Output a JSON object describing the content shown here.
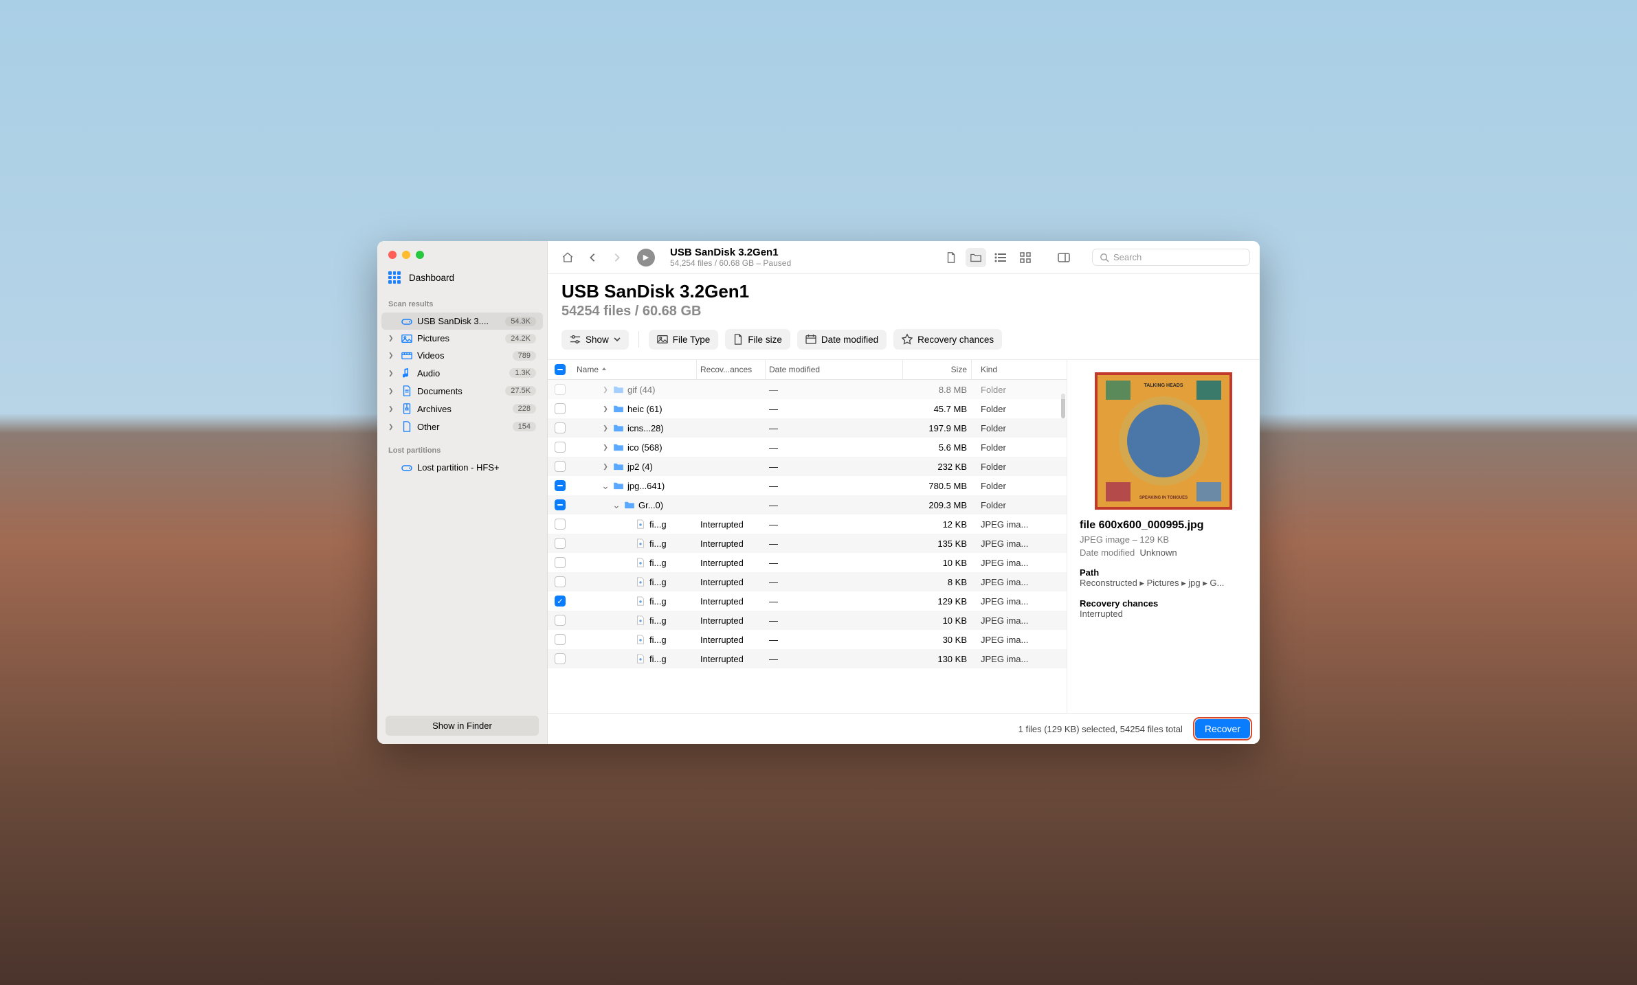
{
  "sidebar": {
    "dashboard_label": "Dashboard",
    "section_scan_results": "Scan results",
    "section_lost_partitions": "Lost partitions",
    "items": [
      {
        "label": "USB  SanDisk 3....",
        "badge": "54.3K",
        "icon": "disk",
        "chev": false,
        "active": true
      },
      {
        "label": "Pictures",
        "badge": "24.2K",
        "icon": "image",
        "chev": true
      },
      {
        "label": "Videos",
        "badge": "789",
        "icon": "video",
        "chev": true
      },
      {
        "label": "Audio",
        "badge": "1.3K",
        "icon": "audio",
        "chev": true
      },
      {
        "label": "Documents",
        "badge": "27.5K",
        "icon": "doc",
        "chev": true
      },
      {
        "label": "Archives",
        "badge": "228",
        "icon": "archive",
        "chev": true
      },
      {
        "label": "Other",
        "badge": "154",
        "icon": "other",
        "chev": true
      }
    ],
    "lost_item": "Lost partition - HFS+",
    "show_finder": "Show in Finder"
  },
  "toolbar": {
    "title": "USB  SanDisk 3.2Gen1",
    "subtitle": "54,254 files / 60.68 GB – Paused",
    "search_placeholder": "Search"
  },
  "heading": {
    "title": "USB  SanDisk 3.2Gen1",
    "subtitle": "54254 files / 60.68 GB"
  },
  "filters": {
    "show": "Show",
    "file_type": "File Type",
    "file_size": "File size",
    "date_modified": "Date modified",
    "recovery_chances": "Recovery chances"
  },
  "columns": {
    "name": "Name",
    "recovery": "Recov...ances",
    "date": "Date modified",
    "size": "Size",
    "kind": "Kind"
  },
  "rows": [
    {
      "cb": "none",
      "indent": 2,
      "caret": "right",
      "icon": "folder",
      "name": "gif (44)",
      "rec": "",
      "date": "—",
      "size": "8.8 MB",
      "kind": "Folder",
      "alt": true,
      "faded": true
    },
    {
      "cb": "none",
      "indent": 2,
      "caret": "right",
      "icon": "folder",
      "name": "heic (61)",
      "rec": "",
      "date": "—",
      "size": "45.7 MB",
      "kind": "Folder"
    },
    {
      "cb": "none",
      "indent": 2,
      "caret": "right",
      "icon": "folder",
      "name": "icns...28)",
      "rec": "",
      "date": "—",
      "size": "197.9 MB",
      "kind": "Folder",
      "alt": true
    },
    {
      "cb": "none",
      "indent": 2,
      "caret": "right",
      "icon": "folder",
      "name": "ico (568)",
      "rec": "",
      "date": "—",
      "size": "5.6 MB",
      "kind": "Folder"
    },
    {
      "cb": "none",
      "indent": 2,
      "caret": "right",
      "icon": "folder",
      "name": "jp2 (4)",
      "rec": "",
      "date": "—",
      "size": "232 KB",
      "kind": "Folder",
      "alt": true
    },
    {
      "cb": "ind",
      "indent": 2,
      "caret": "down",
      "icon": "folder",
      "name": "jpg...641)",
      "rec": "",
      "date": "—",
      "size": "780.5 MB",
      "kind": "Folder"
    },
    {
      "cb": "ind",
      "indent": 3,
      "caret": "down",
      "icon": "folder",
      "name": "Gr...0)",
      "rec": "",
      "date": "—",
      "size": "209.3 MB",
      "kind": "Folder",
      "alt": true
    },
    {
      "cb": "none",
      "indent": 4,
      "caret": "",
      "icon": "file",
      "name": "fi...g",
      "rec": "Interrupted",
      "date": "—",
      "size": "12 KB",
      "kind": "JPEG ima..."
    },
    {
      "cb": "none",
      "indent": 4,
      "caret": "",
      "icon": "file",
      "name": "fi...g",
      "rec": "Interrupted",
      "date": "—",
      "size": "135 KB",
      "kind": "JPEG ima...",
      "alt": true
    },
    {
      "cb": "none",
      "indent": 4,
      "caret": "",
      "icon": "file",
      "name": "fi...g",
      "rec": "Interrupted",
      "date": "—",
      "size": "10 KB",
      "kind": "JPEG ima..."
    },
    {
      "cb": "none",
      "indent": 4,
      "caret": "",
      "icon": "file",
      "name": "fi...g",
      "rec": "Interrupted",
      "date": "—",
      "size": "8 KB",
      "kind": "JPEG ima...",
      "alt": true
    },
    {
      "cb": "chk",
      "indent": 4,
      "caret": "",
      "icon": "file",
      "name": "fi...g",
      "rec": "Interrupted",
      "date": "—",
      "size": "129 KB",
      "kind": "JPEG ima..."
    },
    {
      "cb": "none",
      "indent": 4,
      "caret": "",
      "icon": "file",
      "name": "fi...g",
      "rec": "Interrupted",
      "date": "—",
      "size": "10 KB",
      "kind": "JPEG ima...",
      "alt": true
    },
    {
      "cb": "none",
      "indent": 4,
      "caret": "",
      "icon": "file",
      "name": "fi...g",
      "rec": "Interrupted",
      "date": "—",
      "size": "30 KB",
      "kind": "JPEG ima..."
    },
    {
      "cb": "none",
      "indent": 4,
      "caret": "",
      "icon": "file",
      "name": "fi...g",
      "rec": "Interrupted",
      "date": "—",
      "size": "130 KB",
      "kind": "JPEG ima...",
      "alt": true
    }
  ],
  "details": {
    "filename": "file 600x600_000995.jpg",
    "meta": "JPEG image – 129 KB",
    "date_label": "Date modified",
    "date_value": "Unknown",
    "path_label": "Path",
    "path_value": "Reconstructed ▸ Pictures ▸ jpg ▸ G...",
    "rc_label": "Recovery chances",
    "rc_value": "Interrupted",
    "thumb_top": "TALKING HEADS",
    "thumb_bottom": "SPEAKING IN TONGUES"
  },
  "footer": {
    "status": "1 files (129 KB) selected, 54254 files total",
    "recover": "Recover"
  }
}
